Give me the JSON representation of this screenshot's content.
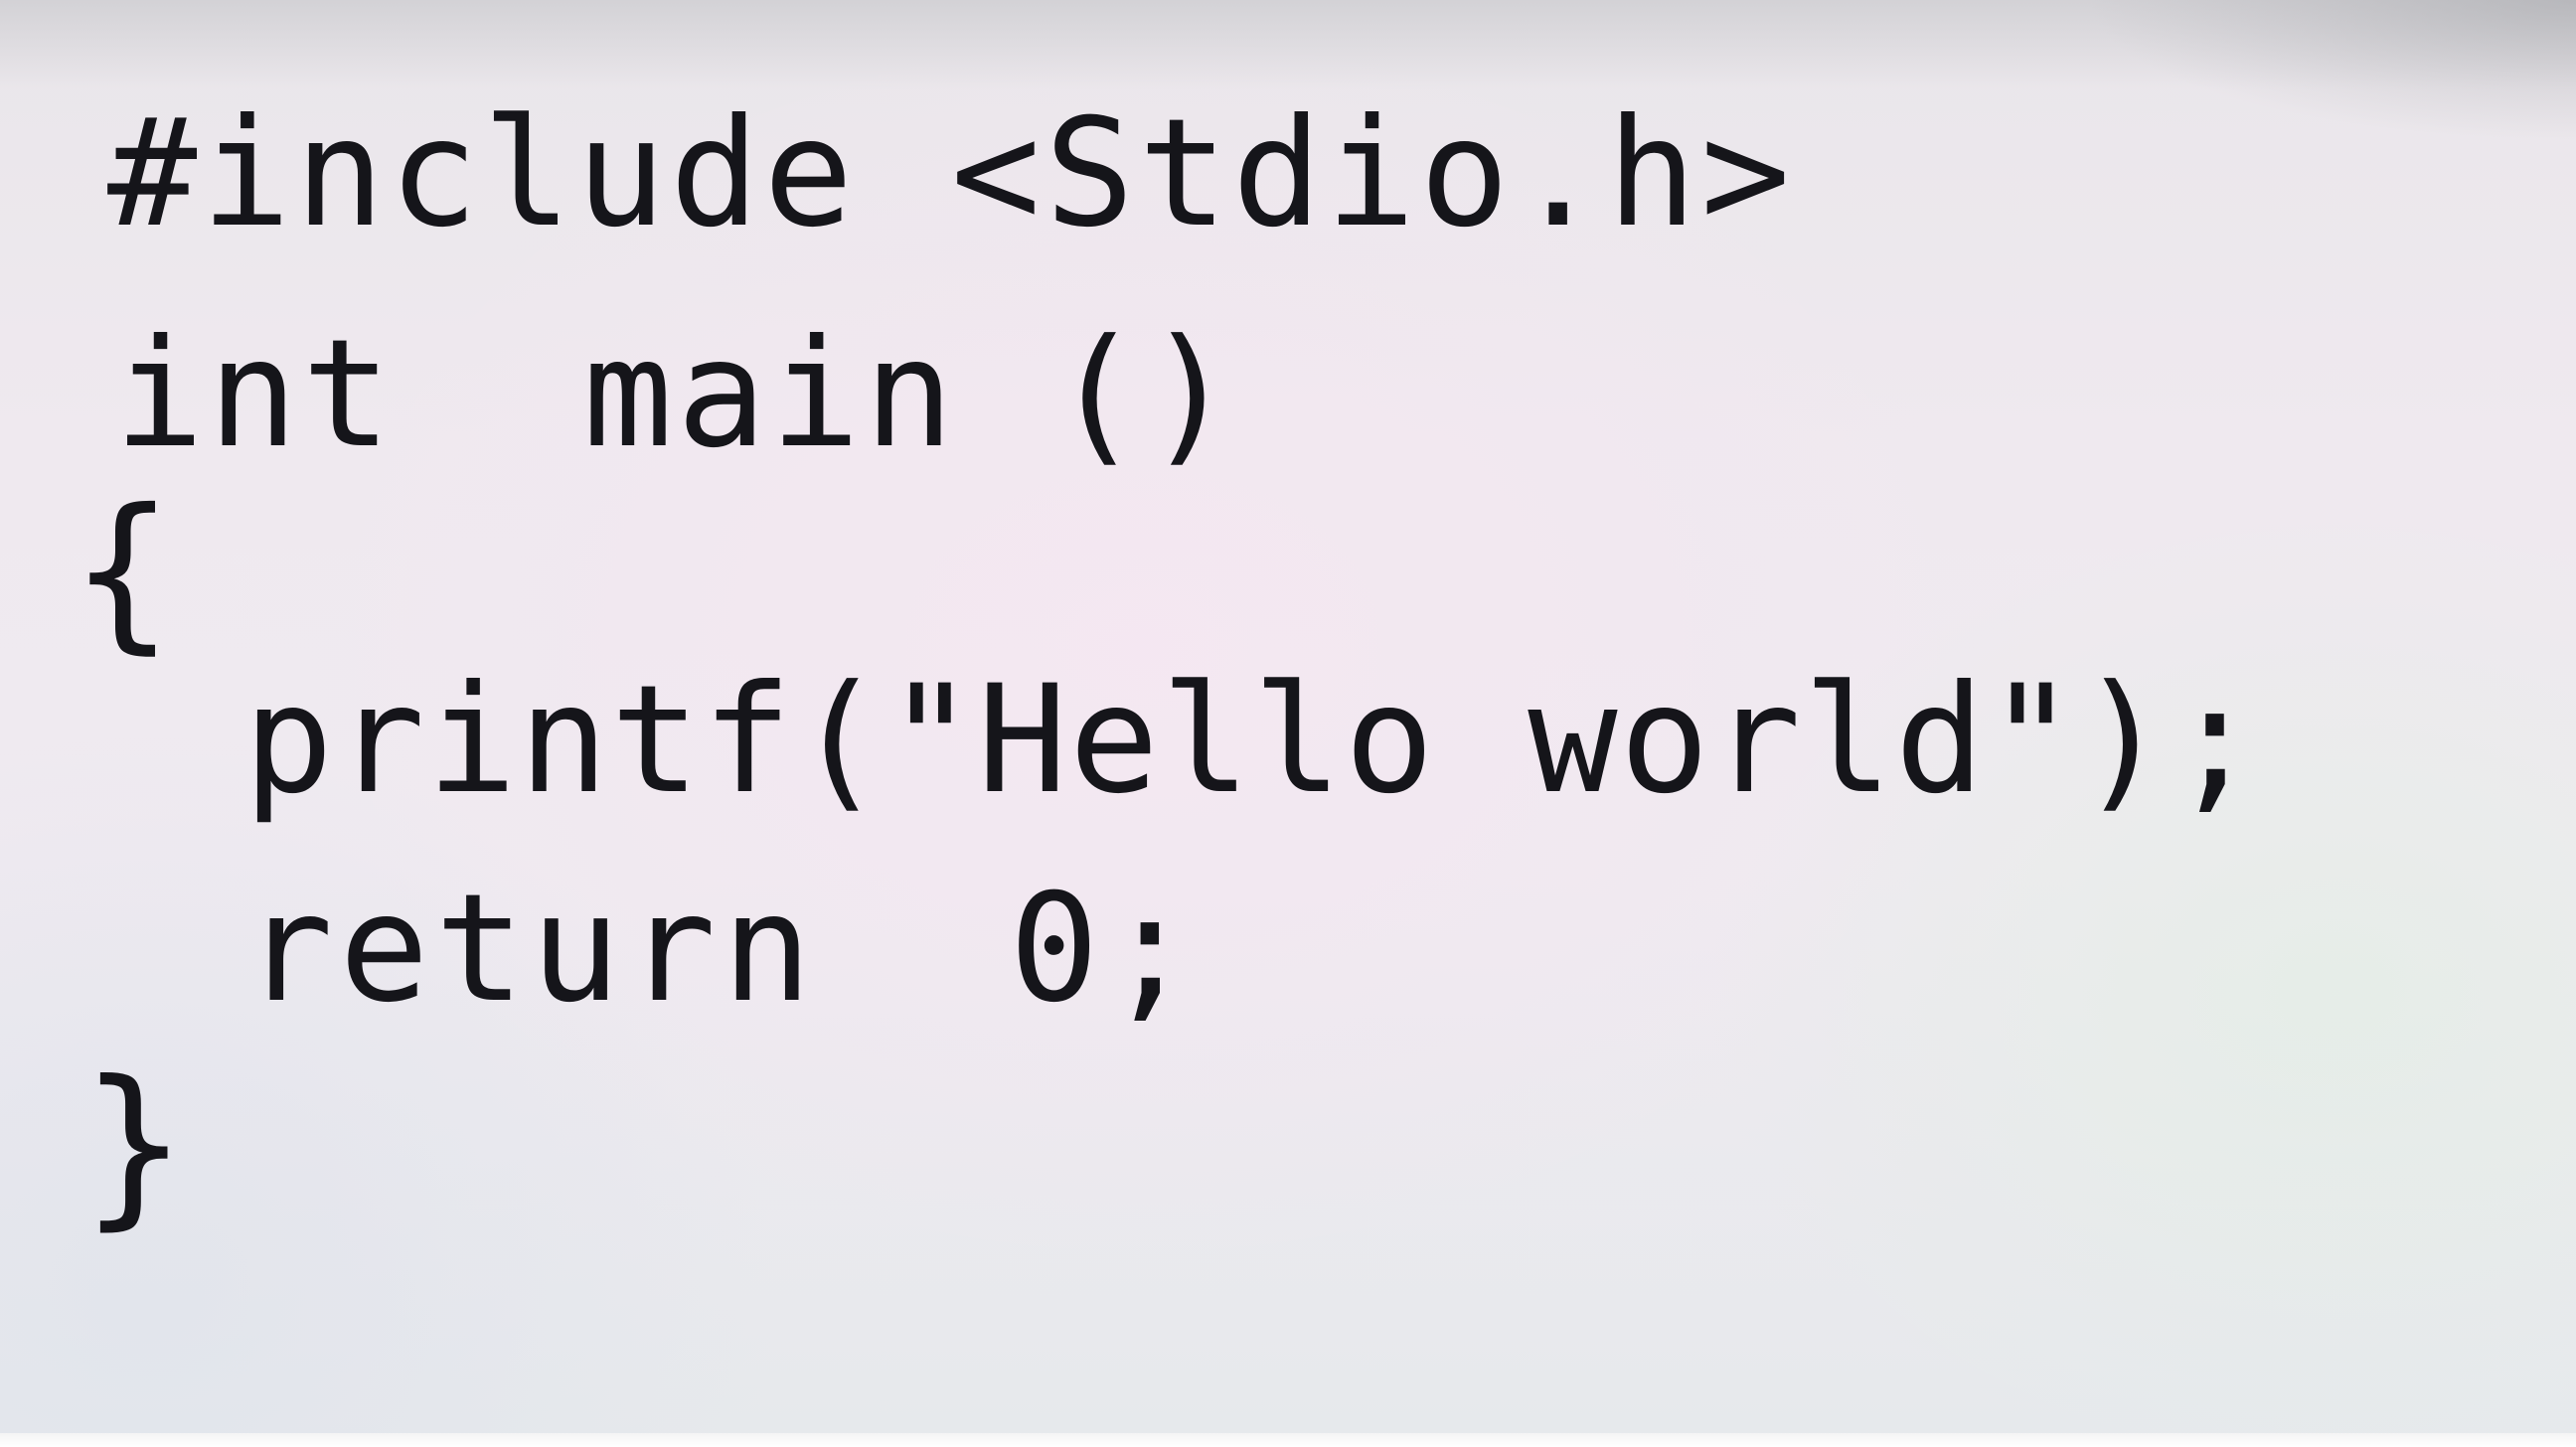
{
  "code_lines": [
    "#include <Stdio.h>",
    "int  main ()",
    "{",
    "printf(\"Hello world\");",
    "return  0;",
    "}"
  ]
}
